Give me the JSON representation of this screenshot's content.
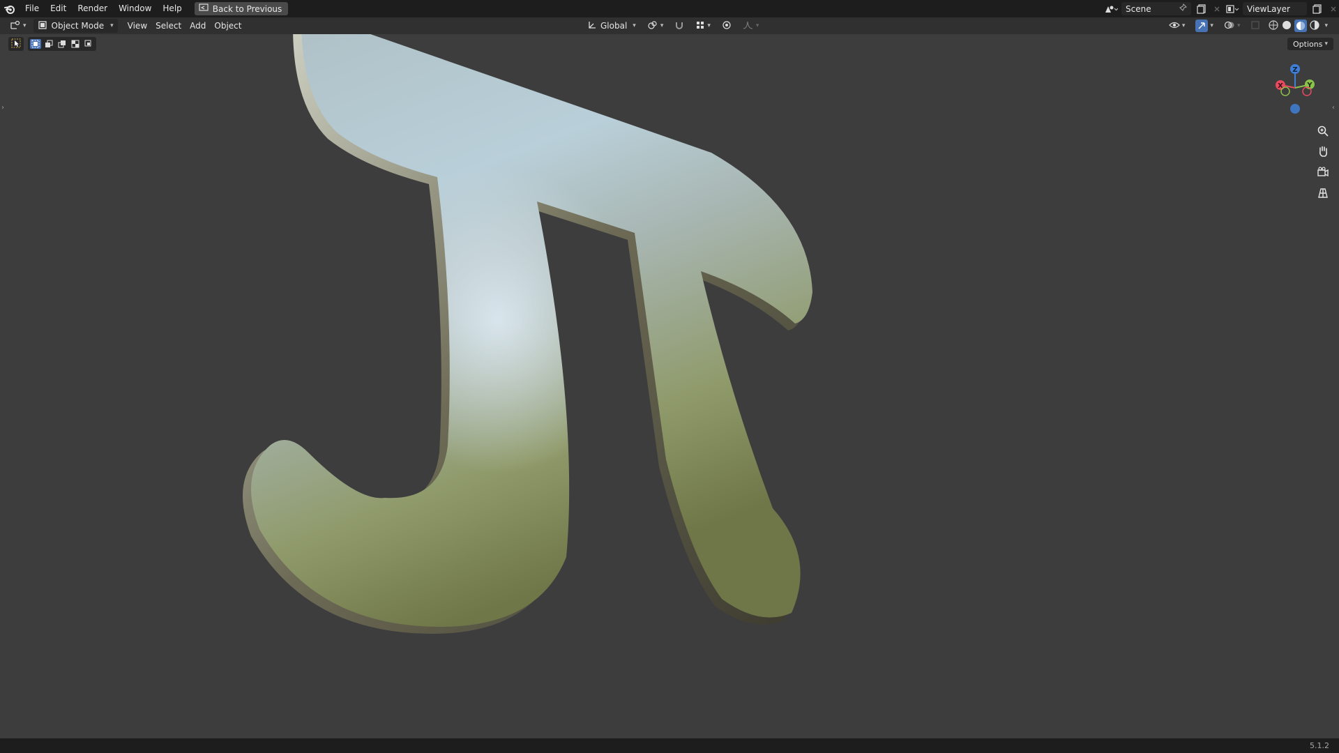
{
  "topbar": {
    "menus": [
      "File",
      "Edit",
      "Render",
      "Window",
      "Help"
    ],
    "back_label": "Back to Previous",
    "scene": "Scene",
    "view_layer": "ViewLayer"
  },
  "header": {
    "mode": "Object Mode",
    "menus": [
      "View",
      "Select",
      "Add",
      "Object"
    ],
    "orientation": "Global",
    "options_label": "Options"
  },
  "viewport": {
    "object_glyph": "π",
    "gizmo_axes": [
      "X",
      "Y",
      "Z"
    ]
  },
  "statusbar": {
    "version": "5.1.2"
  },
  "colors": {
    "accent": "#4772b3",
    "axis_x": "#e84a5f",
    "axis_y": "#8bc34a",
    "axis_z": "#3f7fd6"
  }
}
